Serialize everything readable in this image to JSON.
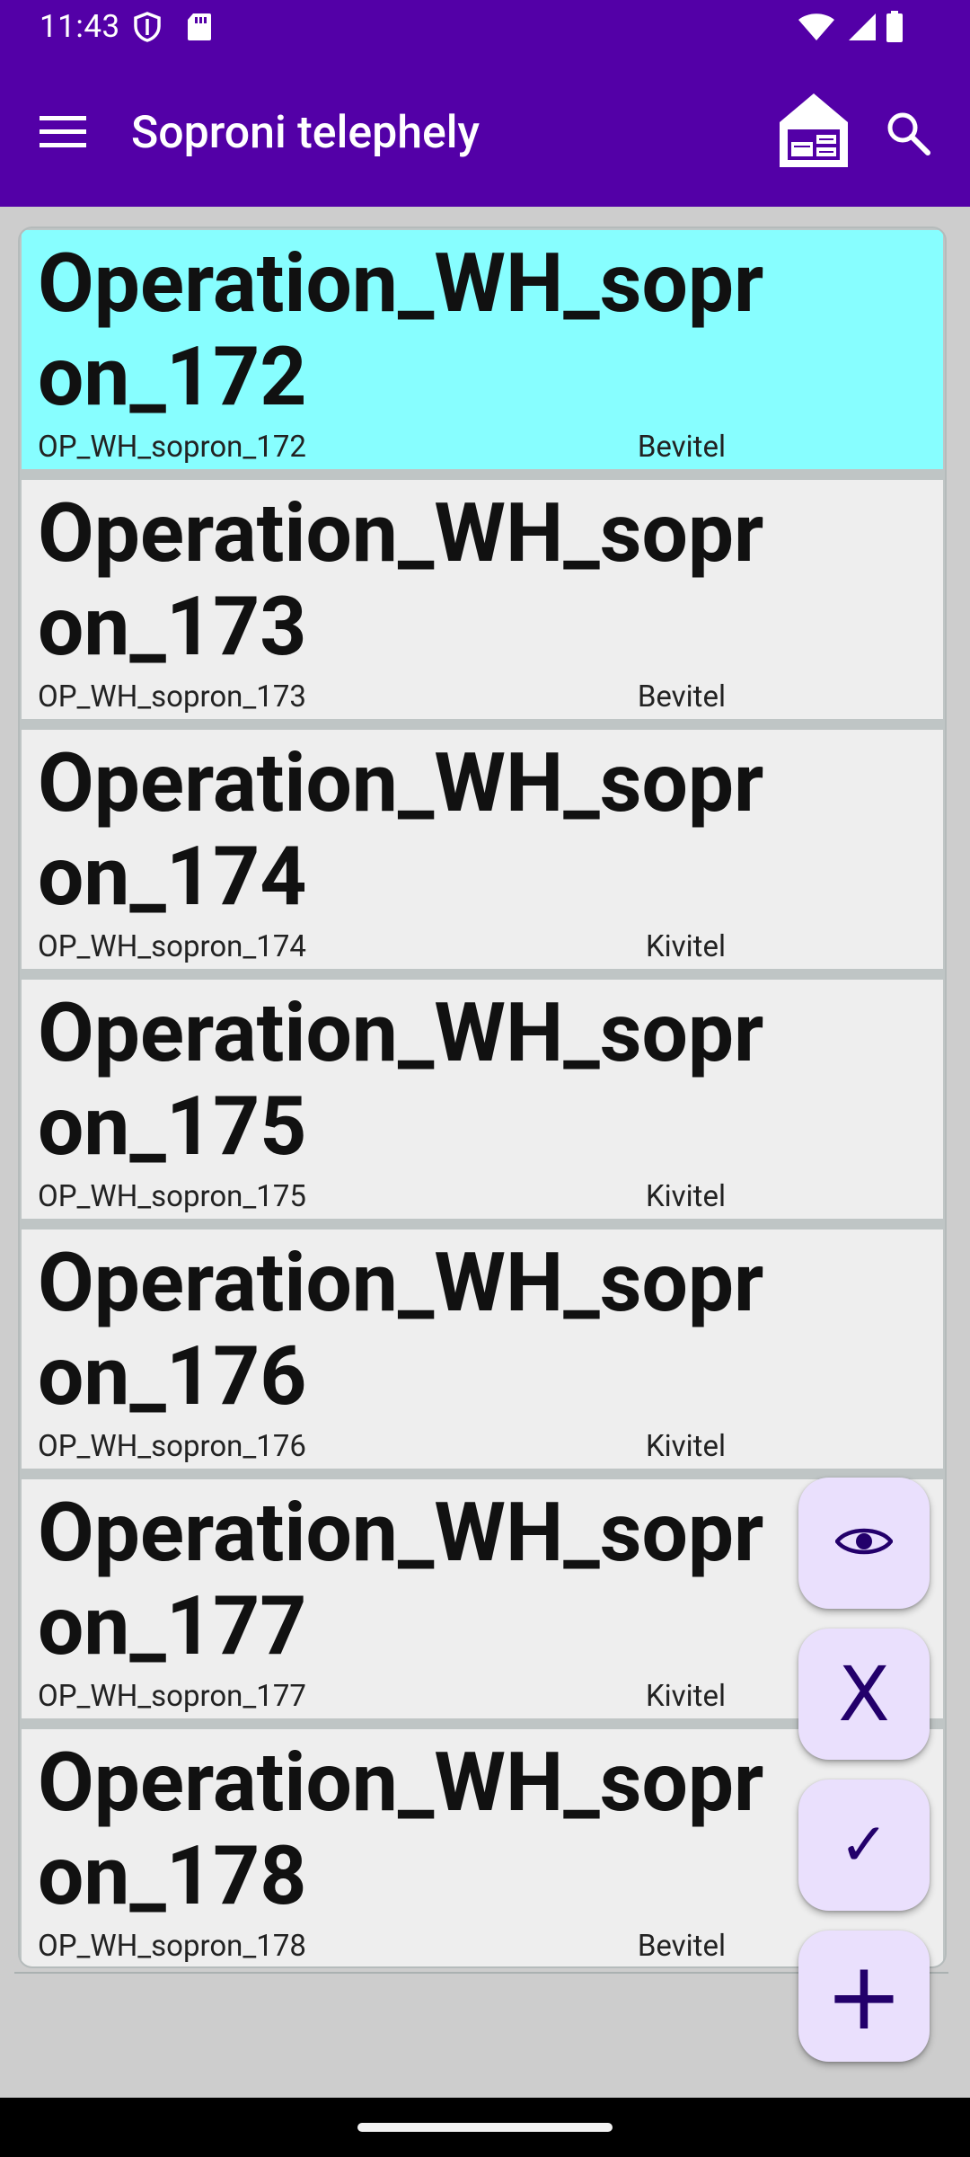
{
  "status_bar": {
    "time": "11:43",
    "icons": [
      "shield-icon",
      "sd-card-icon",
      "wifi-icon",
      "signal-icon",
      "battery-icon"
    ]
  },
  "app_bar": {
    "title": "Soproni telephely",
    "icons": [
      "menu-icon",
      "warehouse-icon",
      "search-icon"
    ],
    "background": "#5300a7"
  },
  "list": {
    "items": [
      {
        "title": "Operation_WH_sopron_172",
        "code": "OP_WH_sopron_172",
        "type": "Bevitel",
        "selected": true
      },
      {
        "title": "Operation_WH_sopron_173",
        "code": "OP_WH_sopron_173",
        "type": "Bevitel",
        "selected": false
      },
      {
        "title": "Operation_WH_sopron_174",
        "code": "OP_WH_sopron_174",
        "type": "Kivitel",
        "selected": false
      },
      {
        "title": "Operation_WH_sopron_175",
        "code": "OP_WH_sopron_175",
        "type": "Kivitel",
        "selected": false
      },
      {
        "title": "Operation_WH_sopron_176",
        "code": "OP_WH_sopron_176",
        "type": "Kivitel",
        "selected": false
      },
      {
        "title": "Operation_WH_sopron_177",
        "code": "OP_WH_sopron_177",
        "type": "Kivitel",
        "selected": false
      },
      {
        "title": "Operation_WH_sopron_178",
        "code": "OP_WH_sopron_178",
        "type": "Bevitel",
        "selected": false
      }
    ],
    "selected_color": "#87feff",
    "row_color": "#eeeeee"
  },
  "fabs": {
    "view_icon": "eye-icon",
    "reject_label": "X",
    "accept_label": "✓",
    "add_label": "+",
    "background": "#eae0fd",
    "foreground": "#23006b"
  }
}
